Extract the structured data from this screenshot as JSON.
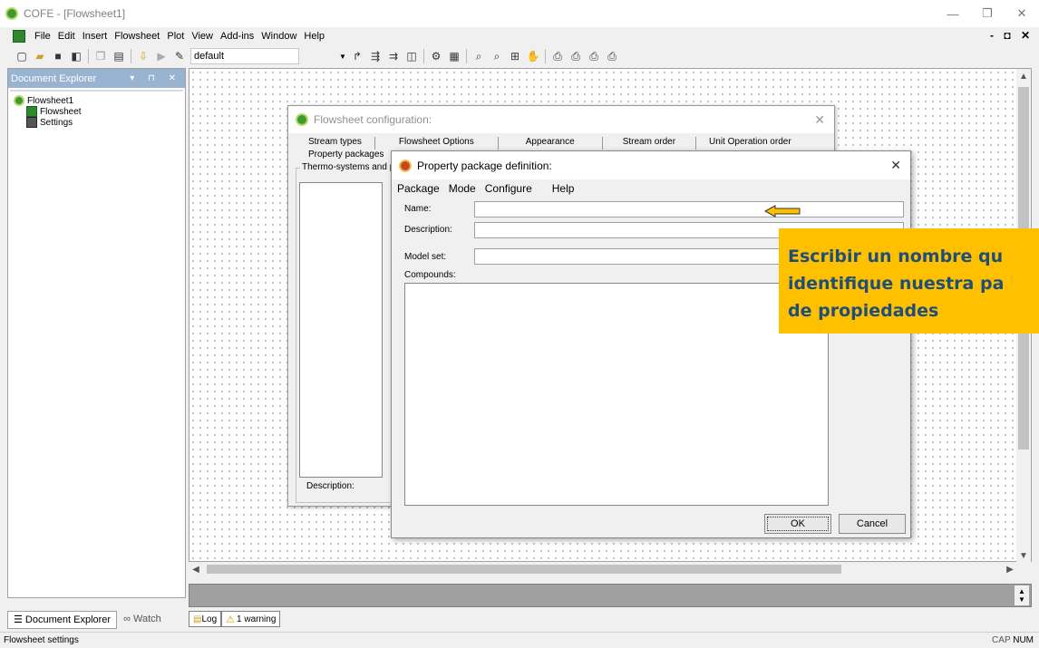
{
  "window": {
    "title": "COFE - [Flowsheet1]",
    "controls": [
      "—",
      "❐",
      "✕"
    ]
  },
  "menubar": {
    "items": [
      "File",
      "Edit",
      "Insert",
      "Flowsheet",
      "Plot",
      "View",
      "Add-ins",
      "Window",
      "Help"
    ],
    "mdi_controls": "- ◘ ✕"
  },
  "toolbar": {
    "combo_value": "default"
  },
  "explorer": {
    "title": "Document Explorer",
    "header_controls": "▾ ⊓ ✕",
    "tree": [
      {
        "label": "Flowsheet1"
      },
      {
        "label": "Flowsheet"
      },
      {
        "label": "Settings"
      }
    ],
    "tabs": [
      "Document Explorer",
      "Watch"
    ]
  },
  "flowsheet_config": {
    "title": "Flowsheet configuration:",
    "tabs_row1": [
      "Stream types",
      "Flowsheet Options",
      "Appearance",
      "Stream order",
      "Unit Operation order"
    ],
    "tab_row2": "Property packages",
    "group_label": "Thermo-systems and property packages",
    "description_label": "Description:"
  },
  "pp_dialog": {
    "title": "Property package definition:",
    "menu": [
      "Package",
      "Mode",
      "Configure",
      "Help"
    ],
    "name_label": "Name:",
    "name_value": "",
    "description_label": "Description:",
    "description_value": "",
    "model_set_label": "Model set:",
    "model_set_value": "",
    "compounds_label": "Compounds:",
    "ok_label": "OK",
    "cancel_label": "Cancel"
  },
  "callout": {
    "text": "Escribir un nombre qu\nidentifique nuestra pa\nde propiedades",
    "bg": "#ffc000",
    "fg": "#1f4e79"
  },
  "log": {
    "tabs": [
      "Log",
      "1 warning"
    ]
  },
  "statusbar": {
    "text": "Flowsheet settings",
    "cap": "CAP",
    "num": "NUM"
  },
  "colors": {
    "accent": "#99b4d1",
    "annotation_arrow": "#ffc000"
  }
}
